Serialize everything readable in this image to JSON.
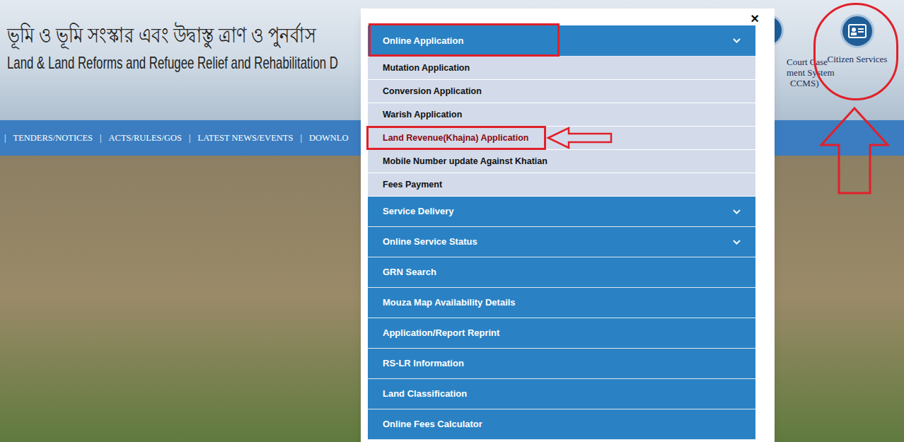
{
  "header": {
    "title_bn": "ভূমি ও ভূমি সংস্কার এবং উদ্বাস্তু ত্রাণ ও পুনর্বাস",
    "title_en": "Land & Land Reforms and Refugee Relief and Rehabilitation D",
    "services": [
      {
        "lines": [
          "Court Case",
          "ment System",
          "CCMS)"
        ],
        "marked": false
      },
      {
        "lines": [
          "Citizen Services"
        ],
        "marked": true
      }
    ]
  },
  "nav": {
    "separator": "|",
    "items": [
      "TENDERS/NOTICES",
      "ACTS/RULES/GOS",
      "LATEST NEWS/EVENTS",
      "DOWNLO"
    ]
  },
  "modal": {
    "close": "×",
    "sections": [
      {
        "label": "Online Application",
        "expandable": true,
        "expanded": true,
        "marked": true,
        "items": [
          {
            "label": "Mutation Application",
            "highlighted": false,
            "marked": false
          },
          {
            "label": "Conversion Application",
            "highlighted": false,
            "marked": false
          },
          {
            "label": "Warish Application",
            "highlighted": false,
            "marked": false
          },
          {
            "label": "Land Revenue(Khajna) Application",
            "highlighted": true,
            "marked": true
          },
          {
            "label": "Mobile Number update Against Khatian",
            "highlighted": false,
            "marked": false
          },
          {
            "label": "Fees Payment",
            "highlighted": false,
            "marked": false
          }
        ]
      },
      {
        "label": "Service Delivery",
        "expandable": true,
        "expanded": false,
        "marked": false,
        "items": []
      },
      {
        "label": "Online Service Status",
        "expandable": true,
        "expanded": false,
        "marked": false,
        "items": []
      },
      {
        "label": "GRN Search",
        "expandable": false,
        "expanded": false,
        "marked": false,
        "items": []
      },
      {
        "label": "Mouza Map Availability Details",
        "expandable": false,
        "expanded": false,
        "marked": false,
        "items": []
      },
      {
        "label": "Application/Report Reprint",
        "expandable": false,
        "expanded": false,
        "marked": false,
        "items": []
      },
      {
        "label": "RS-LR Information",
        "expandable": false,
        "expanded": false,
        "marked": false,
        "items": []
      },
      {
        "label": "Land Classification",
        "expandable": false,
        "expanded": false,
        "marked": false,
        "items": []
      },
      {
        "label": "Online Fees Calculator",
        "expandable": false,
        "expanded": false,
        "marked": false,
        "items": []
      }
    ]
  }
}
